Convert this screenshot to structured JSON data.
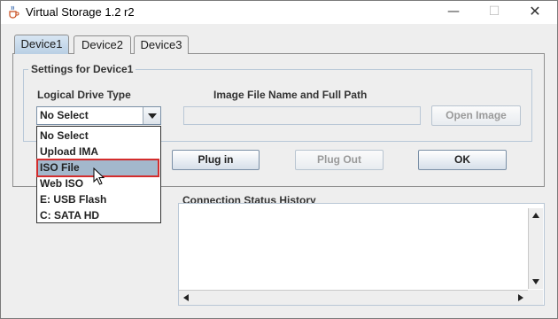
{
  "window": {
    "title": "Virtual Storage 1.2 r2",
    "icon": "java-cup-icon",
    "controls": {
      "minimize": "—",
      "maximize": "☐",
      "close": "✕"
    }
  },
  "tabs": [
    {
      "label": "Device1",
      "active": true
    },
    {
      "label": "Device2",
      "active": false
    },
    {
      "label": "Device3",
      "active": false
    }
  ],
  "settings": {
    "legend": "Settings for Device1",
    "drive_type_label": "Logical Drive Type",
    "drive_type_value": "No Select",
    "image_path_label": "Image File Name and Full Path",
    "image_path_value": "",
    "open_image": "Open Image"
  },
  "dropdown": {
    "options": [
      "No Select",
      "Upload IMA",
      "ISO File",
      "Web ISO",
      "E: USB Flash",
      "C: SATA HD"
    ],
    "highlighted": "ISO File"
  },
  "buttons": {
    "plug_in": "Plug in",
    "plug_out": "Plug Out",
    "ok": "OK"
  },
  "history": {
    "label": "Connection Status History",
    "content": ""
  },
  "colors": {
    "highlight_border": "#d32d2d",
    "selected_option": "#a3b8cc",
    "tab_active": "#b9cfe4"
  }
}
